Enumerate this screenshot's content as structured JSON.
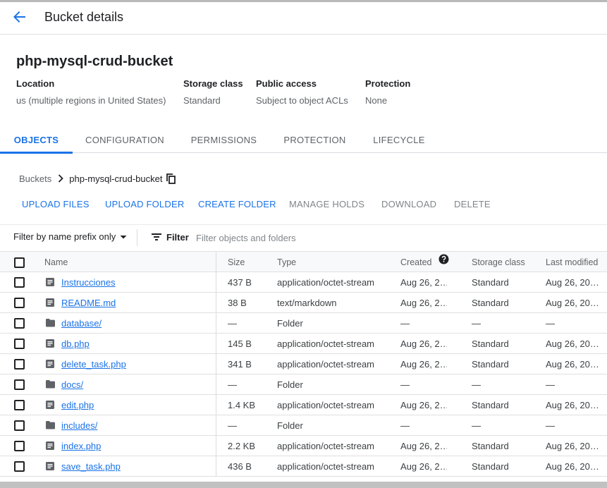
{
  "header": {
    "title": "Bucket details",
    "back_icon": "arrow-back-icon"
  },
  "bucket": {
    "name": "php-mysql-crud-bucket",
    "meta": [
      {
        "label": "Location",
        "value": "us (multiple regions in United States)"
      },
      {
        "label": "Storage class",
        "value": "Standard"
      },
      {
        "label": "Public access",
        "value": "Subject to object ACLs"
      },
      {
        "label": "Protection",
        "value": "None"
      }
    ]
  },
  "tabs": [
    {
      "label": "OBJECTS",
      "active": true
    },
    {
      "label": "CONFIGURATION",
      "active": false
    },
    {
      "label": "PERMISSIONS",
      "active": false
    },
    {
      "label": "PROTECTION",
      "active": false
    },
    {
      "label": "LIFECYCLE",
      "active": false
    }
  ],
  "breadcrumb": {
    "root": "Buckets",
    "current": "php-mysql-crud-bucket"
  },
  "actions": [
    {
      "label": "UPLOAD FILES",
      "enabled": true
    },
    {
      "label": "UPLOAD FOLDER",
      "enabled": true
    },
    {
      "label": "CREATE FOLDER",
      "enabled": true
    },
    {
      "label": "MANAGE HOLDS",
      "enabled": false
    },
    {
      "label": "DOWNLOAD",
      "enabled": false
    },
    {
      "label": "DELETE",
      "enabled": false
    }
  ],
  "filter": {
    "prefix_label": "Filter by name prefix only",
    "label": "Filter",
    "placeholder": "Filter objects and folders"
  },
  "table": {
    "columns": {
      "name": "Name",
      "size": "Size",
      "type": "Type",
      "created": "Created",
      "storage": "Storage class",
      "modified": "Last modified"
    },
    "rows": [
      {
        "name": "Instrucciones",
        "kind": "file",
        "size": "437 B",
        "type": "application/octet-stream",
        "created": "Aug 26, 2…",
        "storage": "Standard",
        "modified": "Aug 26, 20…"
      },
      {
        "name": "README.md",
        "kind": "file",
        "size": "38 B",
        "type": "text/markdown",
        "created": "Aug 26, 2…",
        "storage": "Standard",
        "modified": "Aug 26, 20…"
      },
      {
        "name": "database/",
        "kind": "folder",
        "size": "—",
        "type": "Folder",
        "created": "—",
        "storage": "—",
        "modified": "—"
      },
      {
        "name": "db.php",
        "kind": "file",
        "size": "145 B",
        "type": "application/octet-stream",
        "created": "Aug 26, 2…",
        "storage": "Standard",
        "modified": "Aug 26, 20…"
      },
      {
        "name": "delete_task.php",
        "kind": "file",
        "size": "341 B",
        "type": "application/octet-stream",
        "created": "Aug 26, 2…",
        "storage": "Standard",
        "modified": "Aug 26, 20…"
      },
      {
        "name": "docs/",
        "kind": "folder",
        "size": "—",
        "type": "Folder",
        "created": "—",
        "storage": "—",
        "modified": "—"
      },
      {
        "name": "edit.php",
        "kind": "file",
        "size": "1.4 KB",
        "type": "application/octet-stream",
        "created": "Aug 26, 2…",
        "storage": "Standard",
        "modified": "Aug 26, 20…"
      },
      {
        "name": "includes/",
        "kind": "folder",
        "size": "—",
        "type": "Folder",
        "created": "—",
        "storage": "—",
        "modified": "—"
      },
      {
        "name": "index.php",
        "kind": "file",
        "size": "2.2 KB",
        "type": "application/octet-stream",
        "created": "Aug 26, 2…",
        "storage": "Standard",
        "modified": "Aug 26, 20…"
      },
      {
        "name": "save_task.php",
        "kind": "file",
        "size": "436 B",
        "type": "application/octet-stream",
        "created": "Aug 26, 2…",
        "storage": "Standard",
        "modified": "Aug 26, 20…"
      }
    ]
  },
  "colors": {
    "accent": "#1a73e8",
    "text": "#202124",
    "muted": "#5f6368",
    "disabled": "#80868b"
  }
}
